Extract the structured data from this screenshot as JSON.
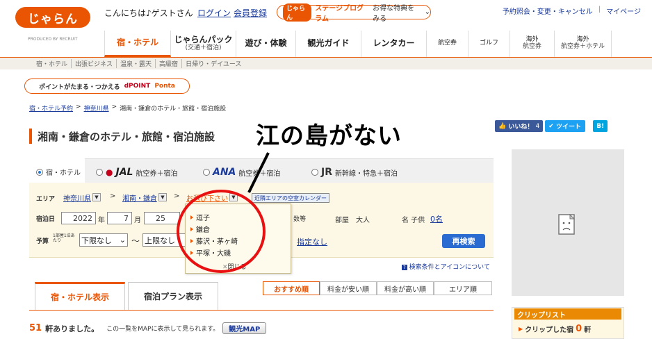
{
  "header": {
    "logo": "じゃらん",
    "logo_sub": "PRODUCED BY RECRUIT",
    "greeting": "こんにちは♪ゲストさん",
    "login": "ログイン",
    "register": "会員登録",
    "stage_tag": "じゃらん",
    "stage_label": "ステージプログラム",
    "stage_benefit": "お得な特典をみる",
    "top_links": [
      "予約照会・変更・キャンセル",
      "マイページ"
    ]
  },
  "nav": {
    "items": [
      {
        "label": "宿・ホテル",
        "sub": ""
      },
      {
        "label": "じゃらんパック",
        "sub": "(交通＋宿泊)"
      },
      {
        "label": "遊び・体験",
        "sub": ""
      },
      {
        "label": "観光ガイド",
        "sub": ""
      },
      {
        "label": "レンタカー",
        "sub": ""
      },
      {
        "label": "航空券",
        "sub": ""
      },
      {
        "label": "ゴルフ",
        "sub": ""
      },
      {
        "label": "海外",
        "sub": "航空券"
      },
      {
        "label": "海外",
        "sub": "航空券＋ホテル"
      }
    ],
    "subitems": [
      "宿・ホテル",
      "出張ビジネス",
      "温泉・露天",
      "高級宿",
      "日帰り・デイユース"
    ]
  },
  "points": {
    "text": "ポイントがたまる・つかえる",
    "dpoint": "dPOINT",
    "ponta": "Ponta"
  },
  "breadcrumb": [
    "宿・ホテル予約",
    "神奈川県",
    "湘南・鎌倉のホテル・旅館・宿泊施設"
  ],
  "page_title": "湘南・鎌倉のホテル・旅館・宿泊施設",
  "annotation": "江の島がない",
  "social": {
    "like": "いいね！",
    "like_count": "4",
    "tweet": "ツイート",
    "hatena": "B!"
  },
  "search": {
    "types": [
      {
        "label": "宿・ホテル",
        "logo": ""
      },
      {
        "label": "航空券＋宿泊",
        "logo": "JAL"
      },
      {
        "label": "航空券＋宿泊",
        "logo": "ANA"
      },
      {
        "label": "新幹線・特急＋宿泊",
        "logo": "JR"
      }
    ],
    "area_label": "エリア",
    "pref": "神奈川県",
    "region": "湘南・鎌倉",
    "subarea": "お選び下さい",
    "calendar_btn": "近隣エリアの空室カレンダー",
    "date_label": "宿泊日",
    "year": "2022",
    "year_unit": "年",
    "month": "7",
    "month_unit": "月",
    "day": "25",
    "count_label": "数等",
    "room_label": "部屋",
    "adult_label": "大人",
    "child_label": "名 子供",
    "child_value": "0名",
    "budget_label": "予算",
    "budget_sub": "1部屋1泊あたり",
    "budget_min": "下限なし",
    "tilde": "〜",
    "budget_max": "上限なし",
    "unspecified": "指定なし",
    "research": "再検索"
  },
  "dropdown": {
    "items": [
      "逗子",
      "鎌倉",
      "藤沢・茅ヶ崎",
      "平塚・大磯"
    ],
    "close": "閉じる"
  },
  "help": "検索条件とアイコンについて",
  "results": {
    "tab_hotel": "宿・ホテル表示",
    "tab_plan": "宿泊プラン表示",
    "sorts": [
      "おすすめ順",
      "料金が安い順",
      "料金が高い順",
      "エリア順"
    ],
    "count": "51",
    "count_text": "軒ありました。",
    "map_hint": "この一覧をMAPに表示して見られます。",
    "map_btn": "観光MAP"
  },
  "clip": {
    "title": "クリップリスト",
    "label": "クリップした宿",
    "count": "0",
    "unit": "軒"
  }
}
